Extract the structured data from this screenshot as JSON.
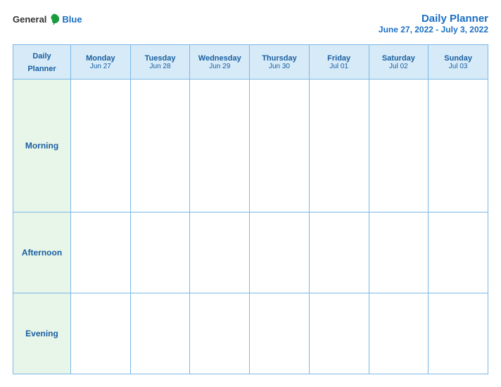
{
  "logo": {
    "general": "General",
    "blue": "Blue"
  },
  "header": {
    "title": "Daily Planner",
    "date_range": "June 27, 2022 - July 3, 2022"
  },
  "columns": [
    {
      "id": "label",
      "day": "Daily",
      "day2": "Planner",
      "date": ""
    },
    {
      "id": "mon",
      "day": "Monday",
      "date": "Jun 27"
    },
    {
      "id": "tue",
      "day": "Tuesday",
      "date": "Jun 28"
    },
    {
      "id": "wed",
      "day": "Wednesday",
      "date": "Jun 29"
    },
    {
      "id": "thu",
      "day": "Thursday",
      "date": "Jun 30"
    },
    {
      "id": "fri",
      "day": "Friday",
      "date": "Jul 01"
    },
    {
      "id": "sat",
      "day": "Saturday",
      "date": "Jul 02"
    },
    {
      "id": "sun",
      "day": "Sunday",
      "date": "Jul 03"
    }
  ],
  "rows": [
    {
      "label": "Morning"
    },
    {
      "label": "Afternoon"
    },
    {
      "label": "Evening"
    }
  ]
}
